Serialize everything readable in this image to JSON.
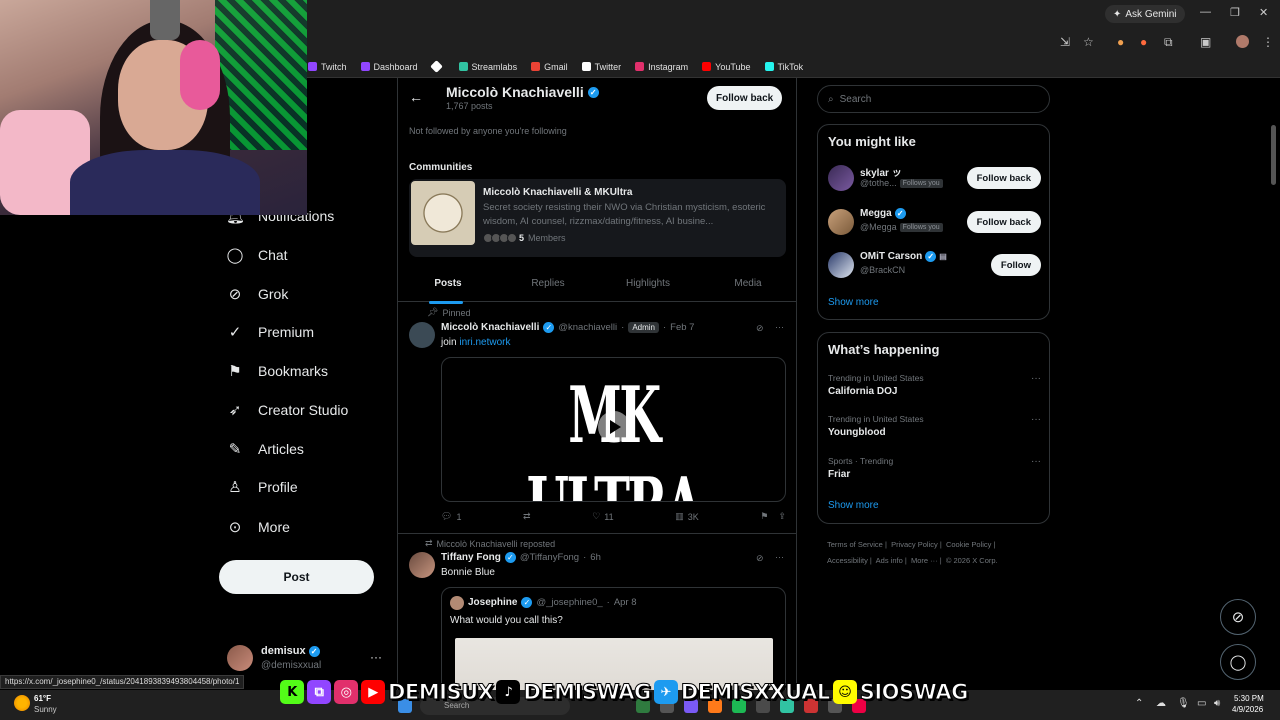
{
  "browser": {
    "gemini_label": "Ask Gemini",
    "bookmarks": [
      {
        "label": "Twitch",
        "color": "#9146ff"
      },
      {
        "label": "Dashboard",
        "color": "#9146ff"
      },
      {
        "label": "",
        "color": "#ffffff"
      },
      {
        "label": "Streamlabs",
        "color": "#31c3a2"
      },
      {
        "label": "Gmail",
        "color": "#ea4335"
      },
      {
        "label": "Twitter",
        "color": "#ffffff"
      },
      {
        "label": "Instagram",
        "color": "#e1306c"
      },
      {
        "label": "YouTube",
        "color": "#ff0000"
      },
      {
        "label": "TikTok",
        "color": "#25f4ee"
      }
    ],
    "status_url": "https://x.com/_josephine0_/status/2041893839493804458/photo/1"
  },
  "nav": {
    "items": [
      {
        "label": "Notifications",
        "icon": "bell-icon"
      },
      {
        "label": "Chat",
        "icon": "chat-icon"
      },
      {
        "label": "Grok",
        "icon": "grok-icon"
      },
      {
        "label": "Premium",
        "icon": "premium-icon"
      },
      {
        "label": "Bookmarks",
        "icon": "bookmark-icon"
      },
      {
        "label": "Creator Studio",
        "icon": "rocket-icon"
      },
      {
        "label": "Articles",
        "icon": "article-icon"
      },
      {
        "label": "Profile",
        "icon": "person-icon"
      },
      {
        "label": "More",
        "icon": "more-icon"
      }
    ],
    "post_label": "Post",
    "account": {
      "name": "demisux",
      "handle": "@demisxxual"
    }
  },
  "profile": {
    "name": "Miccolò Knachiavelli",
    "posts_count": "1,767 posts",
    "follow_back_label": "Follow back",
    "not_followed": "Not followed by anyone you're following",
    "communities_heading": "Communities",
    "community": {
      "title": "Miccolò Knachiavelli & MKUltra",
      "description": "Secret society resisting their NWO via Christian mysticism, esoteric wisdom, AI counsel, rizzmax/dating/fitness, AI busine...",
      "member_count": "5",
      "members_label": "Members"
    },
    "tabs": [
      "Posts",
      "Replies",
      "Highlights",
      "Media"
    ]
  },
  "tweets": {
    "pinned": {
      "label": "Pinned",
      "name": "Miccolò Knachiavelli",
      "handle": "@knachiavelli",
      "badge": "Admin",
      "date": "Feb 7",
      "text_prefix": "join",
      "link": "inri.network",
      "media_title": "MK ULTRA",
      "replies": "1",
      "likes": "11",
      "views": "3K"
    },
    "repost": {
      "label": "Miccolò Knachiavelli reposted",
      "name": "Tiffany Fong",
      "handle": "@TiffanyFong",
      "date": "6h",
      "text": "Bonnie Blue",
      "quote": {
        "name": "Josephine",
        "handle": "@_josephine0_",
        "date": "Apr 8",
        "text": "What would you call this?"
      }
    }
  },
  "right": {
    "search_placeholder": "Search",
    "might_like_heading": "You might like",
    "suggestions": [
      {
        "name": "skylar ッ",
        "handle": "@tothe...",
        "follows_you": "Follows you",
        "button": "Follow back",
        "verified": false
      },
      {
        "name": "Megga",
        "handle": "@Megga",
        "follows_you": "Follows you",
        "button": "Follow back",
        "verified": true
      },
      {
        "name": "OMiT Carson",
        "handle": "@BrackCN",
        "follows_you": "",
        "button": "Follow",
        "verified": true
      }
    ],
    "show_more": "Show more",
    "happening_heading": "What’s happening",
    "trends": [
      {
        "context": "Trending in United States",
        "name": "California DOJ"
      },
      {
        "context": "Trending in United States",
        "name": "Youngblood"
      },
      {
        "context": "Sports · Trending",
        "name": "Friar"
      }
    ],
    "footer": [
      "Terms of Service",
      "Privacy Policy",
      "Cookie Policy",
      "Accessibility",
      "Ads info",
      "More ···",
      "© 2026 X Corp."
    ]
  },
  "banner": {
    "segments": [
      "DEMISUX",
      "DEMISWAG",
      "DEMISXXUAL",
      "SIOSWAG"
    ]
  },
  "taskbar": {
    "temp": "61°F",
    "condition": "Sunny",
    "search_placeholder": "Search",
    "time": "5:30 PM",
    "date": "4/9/2026"
  }
}
